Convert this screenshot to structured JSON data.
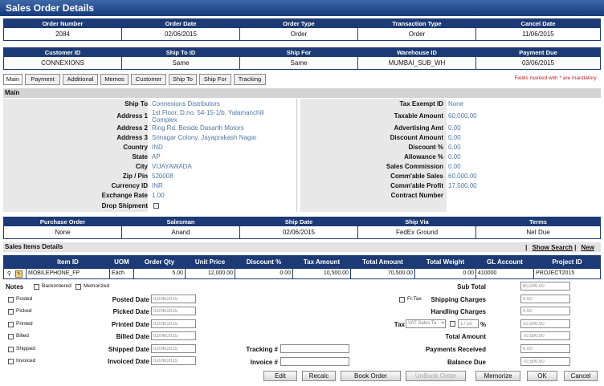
{
  "title": "Sales Order Details",
  "header1": {
    "labels": [
      "Order Number",
      "Order Date",
      "Order Type",
      "Transaction Type",
      "Cancel Date"
    ],
    "values": [
      "2084",
      "02/06/2015",
      "Order",
      "Order",
      "11/06/2015"
    ]
  },
  "header2": {
    "labels": [
      "Customer ID",
      "Ship To ID",
      "Ship For",
      "Warehouse ID",
      "Payment Due"
    ],
    "values": [
      "CONNEXIONS",
      "Same",
      "Same",
      "MUMBAI_SUB_WH",
      "03/06/2015"
    ]
  },
  "tabs": [
    "Main",
    "Payment",
    "Additional",
    "Memos",
    "Customer",
    "Ship To",
    "Ship For",
    "Tracking"
  ],
  "mandatory_note": "Fields marked with * are mandatory.",
  "main": {
    "section": "Main",
    "left_fields": [
      {
        "label": "Ship To",
        "value": "Connexions Distributors"
      },
      {
        "label": "Address 1",
        "value": "1st Floor, D.no. 54-15-1/b, Yalamanchili Complex"
      },
      {
        "label": "Address 2",
        "value": "Ring Rd. Beside Dasarth Motors"
      },
      {
        "label": "Address 3",
        "value": "Srinagar Colony, Jayaprakash Nagar"
      },
      {
        "label": "Country",
        "value": "IND"
      },
      {
        "label": "State",
        "value": "AP"
      },
      {
        "label": "City",
        "value": "VIJAYAWADA"
      },
      {
        "label": "Zip / Pin",
        "value": "520008"
      },
      {
        "label": "Currency ID",
        "value": "INR"
      },
      {
        "label": "Exchange Rate",
        "value": "1.00"
      },
      {
        "label": "Drop Shipment",
        "value": ""
      }
    ],
    "right_fields": [
      {
        "label": "Tax Exempt ID",
        "value": "None"
      },
      {
        "label": "Taxable Amount",
        "value": "60,000.00"
      },
      {
        "label": "Advertising Amt",
        "value": "0.00"
      },
      {
        "label": "Discount Amount",
        "value": "0.00"
      },
      {
        "label": "Discount %",
        "value": "0.00"
      },
      {
        "label": "Allowance %",
        "value": "0.00"
      },
      {
        "label": "Sales Commission",
        "value": "0.00"
      },
      {
        "label": "Comm'able Sales",
        "value": "60,000.00"
      },
      {
        "label": "Comm'able Profit",
        "value": "17,500.00"
      },
      {
        "label": "Contract Number",
        "value": ""
      }
    ]
  },
  "header3": {
    "labels": [
      "Purchase Order",
      "Salesman",
      "Ship Date",
      "Ship Via",
      "Terms"
    ],
    "values": [
      "None",
      "Anand",
      "02/06/2015",
      "FedEx Ground",
      "Net Due"
    ]
  },
  "items": {
    "title": "Sales Items Details",
    "show_search": "Show Search",
    "new_link": "New",
    "columns": [
      "Item ID",
      "UOM",
      "Order Qty",
      "Unit Price",
      "Discount %",
      "Tax Amount",
      "Total Amount",
      "Total Weight",
      "GL Account",
      "Project ID"
    ],
    "rows": [
      [
        "MOBILEPHONE_FP",
        "Each",
        "5.00",
        "12,000.00",
        "0.00",
        "10,500.00",
        "70,500.00",
        "0.00",
        "410000",
        "PROJECT2015"
      ]
    ]
  },
  "notes": {
    "label": "Notes",
    "backordered": "Backordered",
    "memorized": "Memorized",
    "status_labels": [
      "Posted",
      "Picked",
      "Printed",
      "Billed",
      "Shipped",
      "Invoiced"
    ],
    "date_labels": [
      "Posted Date",
      "Picked Date",
      "Printed Date",
      "Billed Date",
      "Shipped Date",
      "Invoiced Date"
    ],
    "dates": [
      "02/06/2015",
      "02/06/2015",
      "02/06/2015",
      "02/06/2015",
      "02/06/2015",
      "02/06/2015"
    ],
    "tracking_label": "Tracking #",
    "invoice_label": "Invoice #"
  },
  "totals": {
    "sub_total_label": "Sub Total",
    "sub_total": "60,000.00",
    "fr_tax": "Fr.Tax",
    "shipping_label": "Shipping Charges",
    "shipping": "0.00",
    "handling_label": "Handling Charges",
    "handling": "0.00",
    "tax_label": "Tax",
    "tax_type": "VAT Sales Ta",
    "tax_rate": "17.50",
    "tax_pct": "%",
    "tax": "10,500.00",
    "total_label": "Total Amount",
    "total": "70,500.00",
    "payments_label": "Payments Received",
    "payments": "0.00",
    "balance_label": "Balance Due",
    "balance": "70,500.00"
  },
  "buttons": [
    "Edit",
    "Recalc",
    "Book Order",
    "UnBook Order",
    "Memorize",
    "OK",
    "Cancel"
  ]
}
